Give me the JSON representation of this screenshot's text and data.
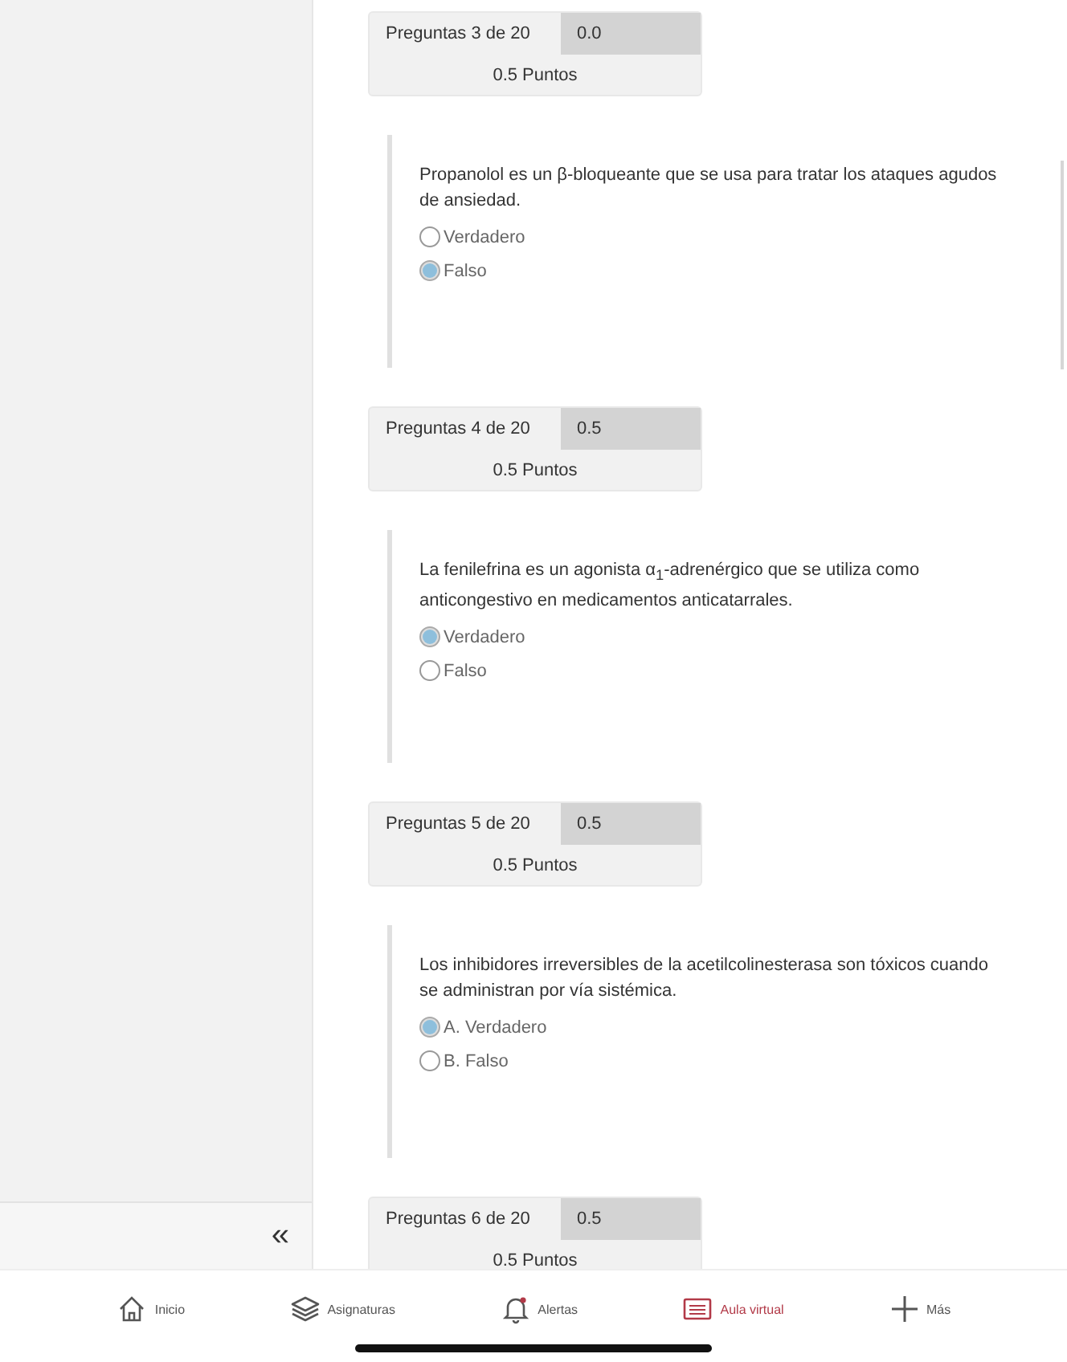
{
  "questions": [
    {
      "counter": "Preguntas 3 de 20",
      "score": "0.0",
      "points": "0.5 Puntos",
      "text": "Propanolol es un β-bloqueante que se usa para tratar los ataques agudos de ansiedad.",
      "options": [
        {
          "label": "Verdadero",
          "selected": false
        },
        {
          "label": "Falso",
          "selected": true
        }
      ]
    },
    {
      "counter": "Preguntas 4 de 20",
      "score": "0.5",
      "points": "0.5 Puntos",
      "text": "La fenilefrina es un agonista α$_{1}$-adrenérgico que se utiliza como anticongestivo en medicamentos anticatarrales.",
      "options": [
        {
          "label": "Verdadero",
          "selected": true
        },
        {
          "label": "Falso",
          "selected": false
        }
      ]
    },
    {
      "counter": "Preguntas 5 de 20",
      "score": "0.5",
      "points": "0.5 Puntos",
      "text": "Los inhibidores irreversibles de la acetilcolinesterasa son tóxicos cuando se administran por vía sistémica.",
      "options": [
        {
          "label": "A. Verdadero",
          "selected": true
        },
        {
          "label": "B. Falso",
          "selected": false
        }
      ]
    },
    {
      "counter": "Preguntas 6 de 20",
      "score": "0.5",
      "points": "0.5 Puntos"
    }
  ],
  "sidebar": {
    "collapse": "«"
  },
  "nav": [
    {
      "kind": "home",
      "label": "Inicio",
      "selected": false
    },
    {
      "kind": "layers",
      "label": "Asignaturas",
      "selected": false
    },
    {
      "kind": "bell",
      "label": "Alertas",
      "selected": false
    },
    {
      "kind": "classroom",
      "label": "Aula virtual",
      "selected": true
    },
    {
      "kind": "plus",
      "label": "Más",
      "selected": false
    }
  ]
}
